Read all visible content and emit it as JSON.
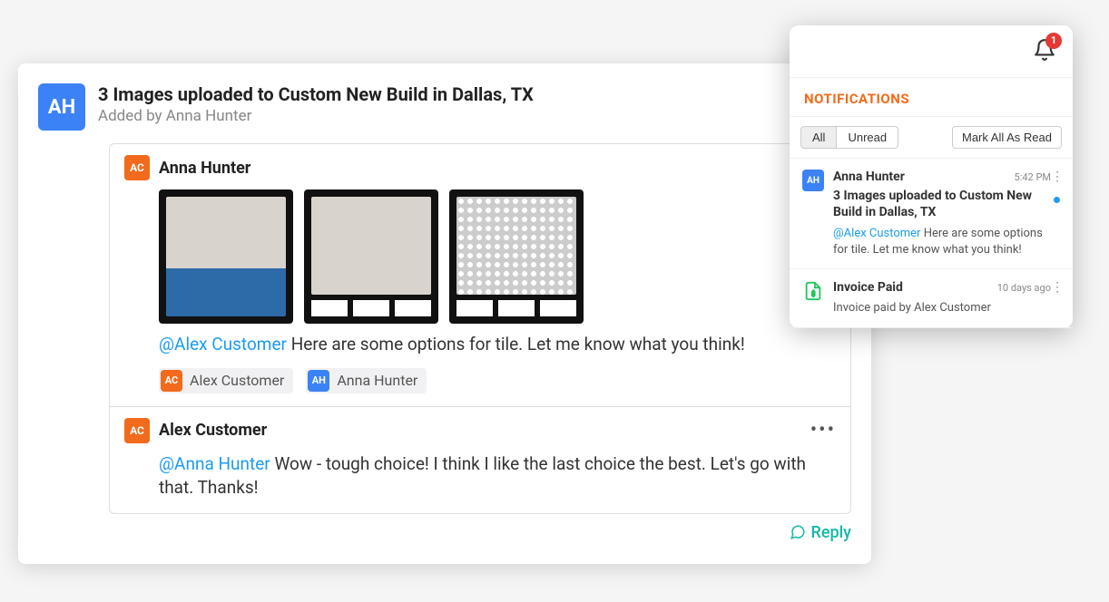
{
  "feed": {
    "avatar_initials": "AH",
    "title": "3 Images uploaded to Custom New Build in Dallas, TX",
    "subtitle": "Added by Anna Hunter",
    "comments": [
      {
        "avatar_initials": "AC",
        "avatar_color": "orange",
        "author": "Anna Hunter",
        "images_count": 3,
        "mention": "@Alex Customer",
        "text_after_mention": " Here are some options for tile. Let me know what you think!",
        "tags": [
          {
            "initials": "AC",
            "color": "orange",
            "label": "Alex Customer"
          },
          {
            "initials": "AH",
            "color": "blue",
            "label": "Anna Hunter"
          }
        ]
      },
      {
        "avatar_initials": "AC",
        "avatar_color": "orange",
        "author": "Alex Customer",
        "mention": "@Anna Hunter",
        "text_after_mention": " Wow - tough choice! I think I like the last choice the best. Let's go with that. Thanks!"
      }
    ],
    "reply_label": "Reply"
  },
  "notifications": {
    "title": "NOTIFICATIONS",
    "badge_count": "1",
    "filters": {
      "all": "All",
      "unread": "Unread"
    },
    "mark_all": "Mark All As Read",
    "items": [
      {
        "avatar_initials": "AH",
        "name": "Anna Hunter",
        "time": "5:42 PM",
        "heading": "3 Images uploaded to Custom New Build in Dallas, TX",
        "mention": "@Alex Customer",
        "body_after_mention": " Here are some options for tile. Let me know what you think!",
        "unread": true
      },
      {
        "name": "Invoice Paid",
        "time": "10 days ago",
        "body": "Invoice paid by Alex Customer"
      }
    ]
  }
}
